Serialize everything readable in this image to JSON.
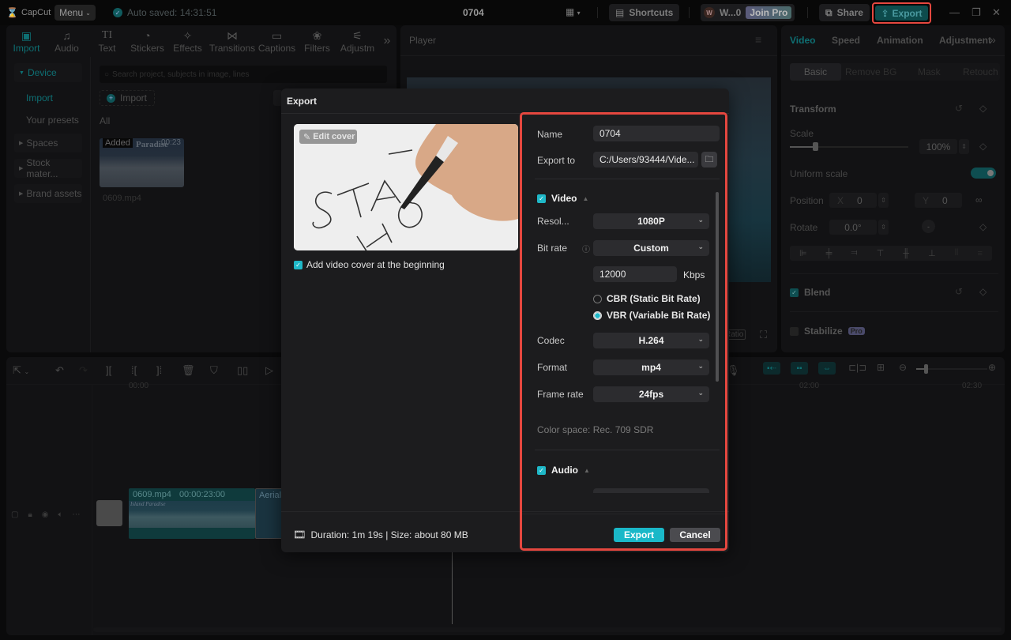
{
  "titlebar": {
    "app_name": "CapCut",
    "menu_label": "Menu",
    "autosave_text": "Auto saved: 14:31:51",
    "project_title": "0704",
    "shortcuts_label": "Shortcuts",
    "account_initial": "W",
    "account_name": "W...0",
    "join_pro_label": "Join Pro",
    "share_label": "Share",
    "export_label": "Export"
  },
  "media_tabs": [
    {
      "label": "Import",
      "icon": "import-icon",
      "glyph": "▣",
      "active": true
    },
    {
      "label": "Audio",
      "icon": "audio-icon",
      "glyph": "♫"
    },
    {
      "label": "Text",
      "icon": "text-icon",
      "glyph": "TI"
    },
    {
      "label": "Stickers",
      "icon": "stickers-icon",
      "glyph": "◔"
    },
    {
      "label": "Effects",
      "icon": "effects-icon",
      "glyph": "✧"
    },
    {
      "label": "Transitions",
      "icon": "transitions-icon",
      "glyph": "⋈"
    },
    {
      "label": "Captions",
      "icon": "captions-icon",
      "glyph": "▭"
    },
    {
      "label": "Filters",
      "icon": "filters-icon",
      "glyph": "❀"
    },
    {
      "label": "Adjustm",
      "icon": "adjustments-icon",
      "glyph": "⚟"
    }
  ],
  "media_sidebar": {
    "device": "Device",
    "import": "Import",
    "your_presets": "Your presets",
    "spaces": "Spaces",
    "stock": "Stock mater...",
    "brand": "Brand assets"
  },
  "media": {
    "search_placeholder": "Search project, subjects in image, lines",
    "import_label": "Import",
    "filter_all": "All",
    "clip_badge": "Added",
    "clip_duration": "00:23",
    "clip_overlay_text": "Paradise",
    "clip_name": "0609.mp4"
  },
  "player": {
    "title": "Player",
    "ratio_label": "Ratio"
  },
  "properties": {
    "tabs": [
      "Video",
      "Speed",
      "Animation",
      "Adjustment"
    ],
    "subtabs": [
      "Basic",
      "Remove BG",
      "Mask",
      "Retouch"
    ],
    "transform_label": "Transform",
    "scale_label": "Scale",
    "scale_value": "100%",
    "scale_slider_fraction": 0.2,
    "uniform_scale_label": "Uniform scale",
    "uniform_scale_on": true,
    "position_label": "Position",
    "pos_x_label": "X",
    "pos_x": "0",
    "pos_y_label": "Y",
    "pos_y": "0",
    "rotate_label": "Rotate",
    "rotate_value": "0.0°",
    "blend_label": "Blend",
    "stabilize_label": "Stabilize",
    "pro_badge": "Pro"
  },
  "timeline": {
    "ruler": [
      "00:00",
      "02:00",
      "02:30"
    ],
    "clip_name": "0609.mp4",
    "clip_duration": "00:00:23:00",
    "clip_overlay_text": "Island Paradise",
    "next_clip_name": "Aerial"
  },
  "export_dialog": {
    "title": "Export",
    "edit_cover_label": "Edit cover",
    "add_cover_label": "Add video cover at the beginning",
    "add_cover_checked": true,
    "duration_text": "Duration: 1m 19s | Size: about 80 MB",
    "name_label": "Name",
    "name_value": "0704",
    "export_to_label": "Export to",
    "export_to_value": "C:/Users/93444/Vide...",
    "video_section": "Video",
    "video_checked": true,
    "resolution_label": "Resol...",
    "resolution_value": "1080P",
    "bitrate_label": "Bit rate",
    "bitrate_value": "Custom",
    "bitrate_custom": "12000",
    "bitrate_unit": "Kbps",
    "cbr_label": "CBR (Static Bit Rate)",
    "vbr_label": "VBR (Variable Bit Rate)",
    "selected_rate_mode": "VBR",
    "codec_label": "Codec",
    "codec_value": "H.264",
    "format_label": "Format",
    "format_value": "mp4",
    "framerate_label": "Frame rate",
    "framerate_value": "24fps",
    "color_space": "Color space: Rec. 709 SDR",
    "audio_section": "Audio",
    "audio_checked": true,
    "export_button": "Export",
    "cancel_button": "Cancel"
  },
  "colors": {
    "accent": "#1ab8c8",
    "highlight_border": "#e5473f",
    "dialog_bg": "#1c1c1e"
  }
}
